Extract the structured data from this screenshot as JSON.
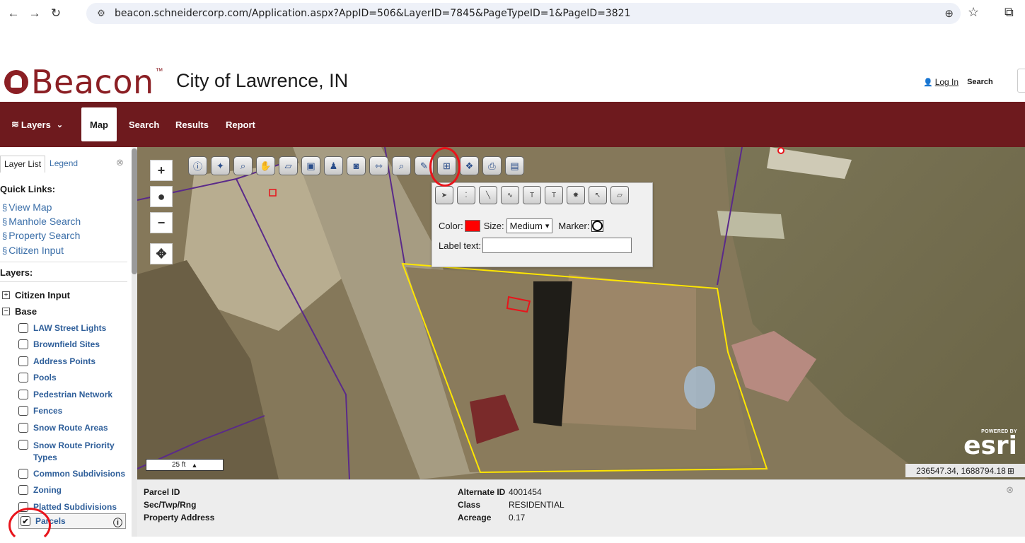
{
  "browser": {
    "url": "beacon.schneidercorp.com/Application.aspx?AppID=506&LayerID=7845&PageTypeID=1&PageID=3821"
  },
  "header": {
    "logo_text": "Beacon",
    "logo_tm": "™",
    "site_title": "City of Lawrence, IN",
    "login_label": "Log In",
    "search_label": "Search"
  },
  "nav": {
    "layers": "Layers",
    "map": "Map",
    "search": "Search",
    "results": "Results",
    "report": "Report"
  },
  "sidebar": {
    "tabs": [
      "Layer List",
      "Legend"
    ],
    "quick_links_heading": "Quick Links:",
    "quick_links": [
      "View Map",
      "Manhole Search",
      "Property Search",
      "Citizen Input"
    ],
    "layers_heading": "Layers:",
    "groups": [
      "Citizen Input",
      "Base"
    ],
    "layers": [
      "LAW Street Lights",
      "Brownfield Sites",
      "Address Points",
      "Pools",
      "Pedestrian Network",
      "Fences",
      "Snow Route Areas",
      "Snow Route Priority Types",
      "Common Subdivisions",
      "Zoning",
      "Platted Subdivisions",
      "Parcels"
    ],
    "checked_layer": "Parcels"
  },
  "map": {
    "draw_panel": {
      "color_label": "Color:",
      "color_value": "#ff0000",
      "size_label": "Size:",
      "size_value": "Medium",
      "marker_label": "Marker:",
      "label_text_label": "Label text:",
      "label_text_value": ""
    },
    "scale_label": "25 ft",
    "esri_powered": "POWERED BY",
    "esri_logo": "esri",
    "coordinates": "236547.34, 1688794.18"
  },
  "info_panel": {
    "parcel_id_label": "Parcel ID",
    "sec_label": "Sec/Twp/Rng",
    "address_label": "Property Address",
    "alt_id_label": "Alternate ID",
    "alt_id_value": "4001454",
    "class_label": "Class",
    "class_value": "RESIDENTIAL",
    "acreage_label": "Acreage",
    "acreage_value": "0.17"
  },
  "colors": {
    "brand": "#8b1f24",
    "nav_bg": "#6e1a1e",
    "link": "#3a6ea8",
    "parcel_outline": "#ffe600",
    "annotation": "#e8141b"
  }
}
